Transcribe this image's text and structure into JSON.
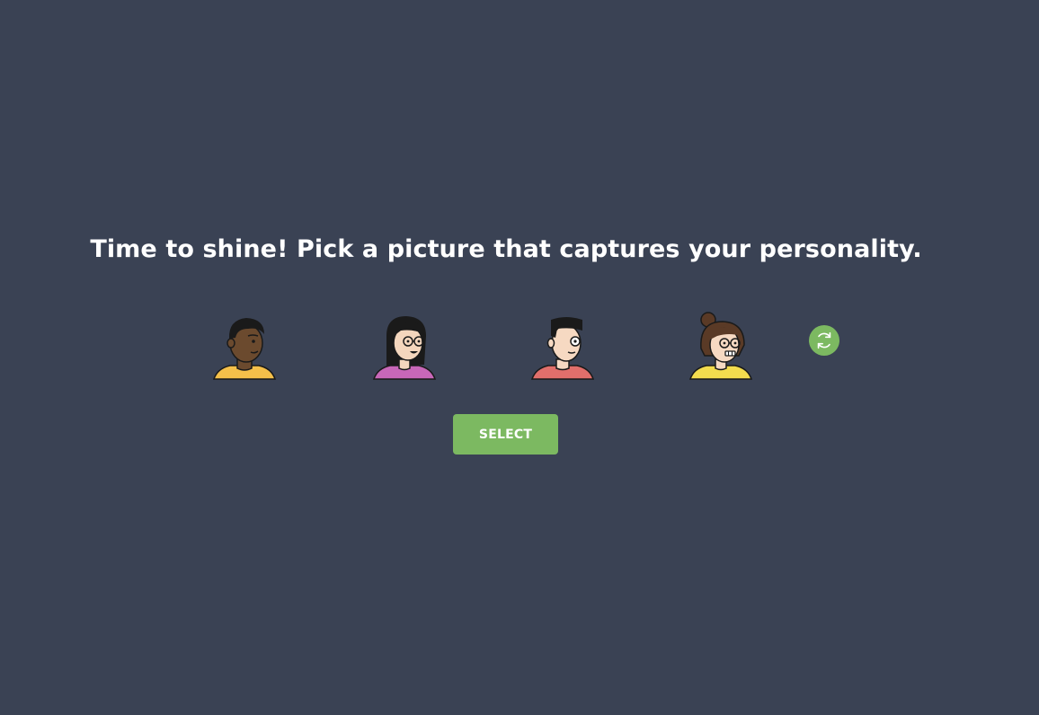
{
  "prompt": {
    "title": "Time to shine! Pick a picture that captures your personality."
  },
  "avatars": [
    {
      "icon": "avatar-man-dark-skin-icon",
      "shirt_color": "#f5c04a",
      "skin_color": "#6b4a2e"
    },
    {
      "icon": "avatar-woman-glasses-long-hair-icon",
      "shirt_color": "#c867b8",
      "skin_color": "#f4d6bd"
    },
    {
      "icon": "avatar-man-short-hair-icon",
      "shirt_color": "#e16f6b",
      "skin_color": "#f6d9c2"
    },
    {
      "icon": "avatar-woman-bun-glasses-icon",
      "shirt_color": "#f3dc4e",
      "skin_color": "#f6d9c2"
    }
  ],
  "refresh": {
    "icon": "refresh-icon"
  },
  "actions": {
    "select_label": "SELECT"
  },
  "colors": {
    "background": "#3a4254",
    "accent": "#7cb961",
    "text": "#ffffff"
  }
}
